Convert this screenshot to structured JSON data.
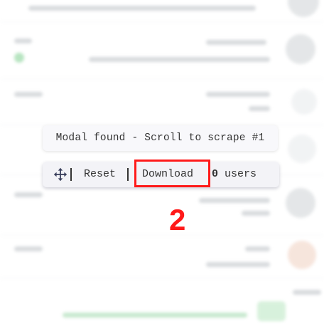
{
  "overlay": {
    "status_text": "Modal found - Scroll to scrape #1",
    "reset_label": "Reset",
    "download_label": "Download",
    "user_count": "0",
    "users_label": "users",
    "move_icon": "move-arrows-icon"
  },
  "annotation": {
    "step_number": "2",
    "color": "#ff1a1a"
  },
  "colors": {
    "toolbar_bg": "#f3f3f7",
    "status_bg": "#f8f8fb",
    "background_accent": "#7dcf8e"
  }
}
